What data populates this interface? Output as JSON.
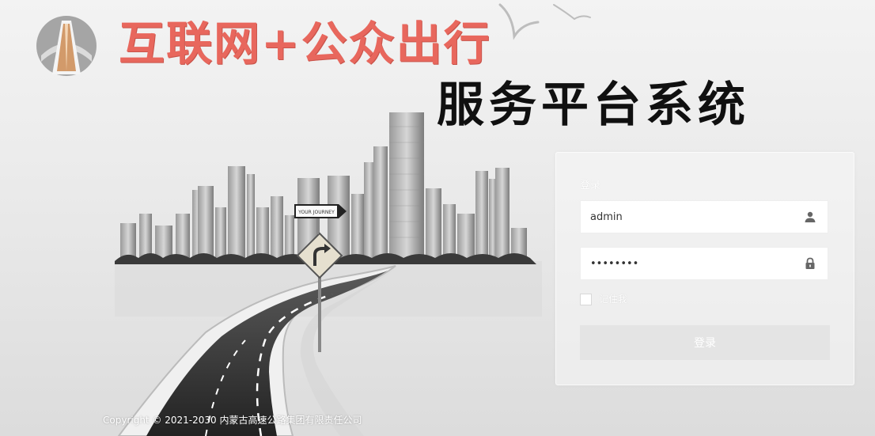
{
  "header": {
    "title_line1": "互联网+公众出行",
    "title_line2": "服务平台系统",
    "logo_icon": "road-logo-icon",
    "title_color": "#e8675d"
  },
  "illustration": {
    "sign_text": "YOUR JOURNEY",
    "icons": [
      "city-skyline-icon",
      "road-icon",
      "turn-right-sign-icon",
      "seagull-icon"
    ]
  },
  "login": {
    "title": "登录",
    "username": {
      "value": "admin",
      "icon": "user-icon"
    },
    "password": {
      "value": "admin123",
      "icon": "lock-icon"
    },
    "remember_label": "记住我",
    "remember_checked": false,
    "submit_label": "登录"
  },
  "footer": {
    "copyright": "Copyright © 2021-2030 内蒙古高速公路集团有限责任公司"
  }
}
